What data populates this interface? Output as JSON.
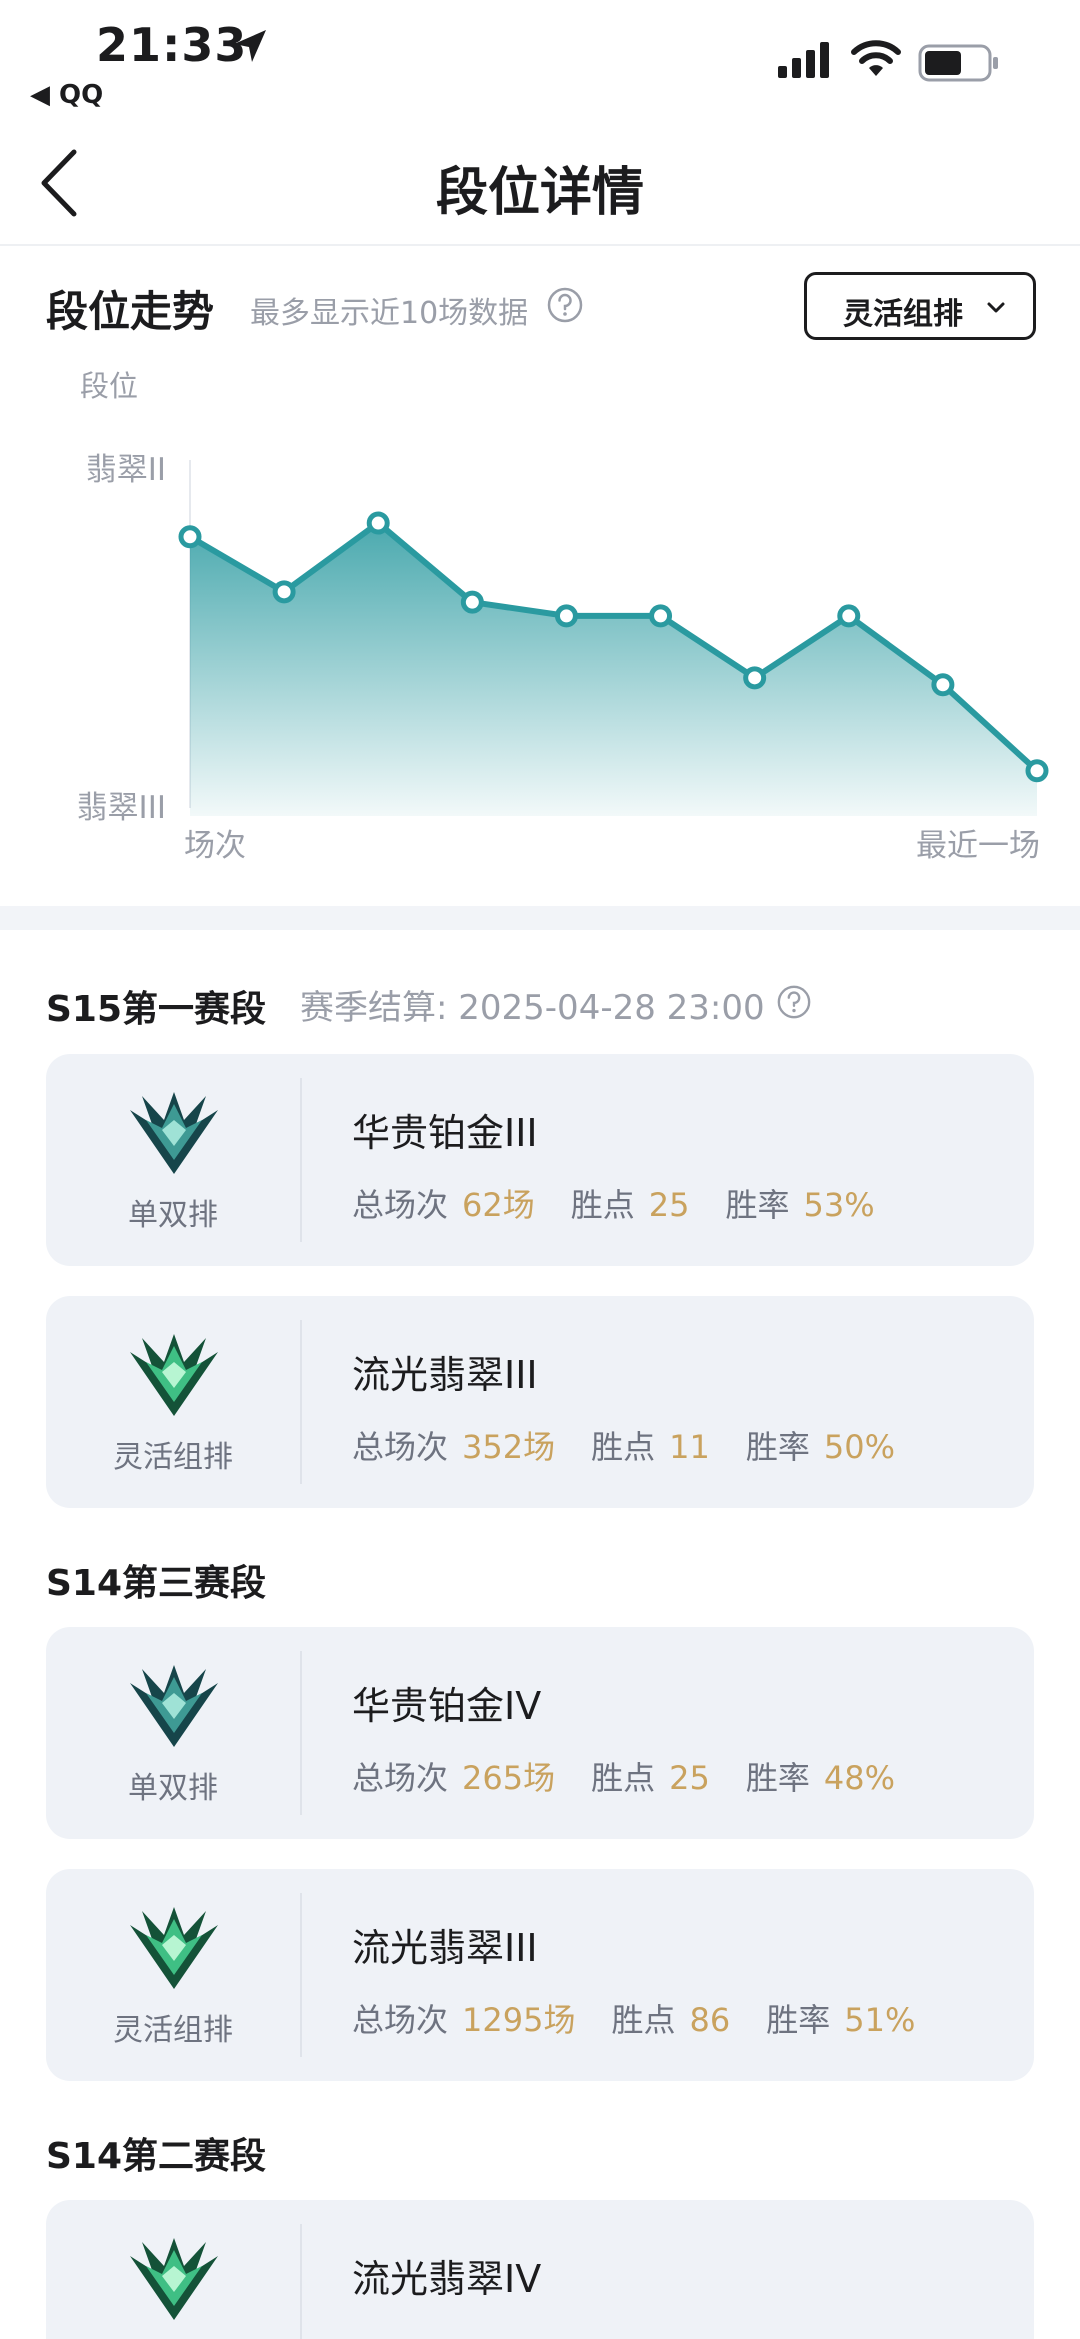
{
  "status_bar": {
    "time": "21:33",
    "back_app": "◀ QQ"
  },
  "nav": {
    "title": "段位详情"
  },
  "trend": {
    "title": "段位走势",
    "subtitle": "最多显示近10场数据",
    "mode_select": "灵活组排"
  },
  "chart_data": {
    "type": "area",
    "ylabel": "段位",
    "y_ticks": [
      "翡翠II",
      "翡翠III"
    ],
    "x_tick_labels": [
      "场次",
      "最近一场"
    ],
    "x": [
      1,
      2,
      3,
      4,
      5,
      6,
      7,
      8,
      9,
      10
    ],
    "values": [
      0.8,
      0.64,
      0.84,
      0.61,
      0.57,
      0.57,
      0.39,
      0.57,
      0.37,
      0.12
    ],
    "ylim": [
      0,
      1
    ],
    "grid": false,
    "color": "#2a9aa0"
  },
  "seasons": [
    {
      "title": "S15第一赛段",
      "settlement": "赛季结算: 2025-04-28 23:00",
      "cards": [
        {
          "queue": "单双排",
          "rank": "华贵铂金III",
          "k_games": "总场次",
          "games": "62场",
          "k_points": "胜点",
          "points": "25",
          "k_rate": "胜率",
          "rate": "53%"
        },
        {
          "queue": "灵活组排",
          "rank": "流光翡翠III",
          "k_games": "总场次",
          "games": "352场",
          "k_points": "胜点",
          "points": "11",
          "k_rate": "胜率",
          "rate": "50%"
        }
      ]
    },
    {
      "title": "S14第三赛段",
      "cards": [
        {
          "queue": "单双排",
          "rank": "华贵铂金IV",
          "k_games": "总场次",
          "games": "265场",
          "k_points": "胜点",
          "points": "25",
          "k_rate": "胜率",
          "rate": "48%"
        },
        {
          "queue": "灵活组排",
          "rank": "流光翡翠III",
          "k_games": "总场次",
          "games": "1295场",
          "k_points": "胜点",
          "points": "86",
          "k_rate": "胜率",
          "rate": "51%"
        }
      ]
    },
    {
      "title": "S14第二赛段",
      "cards": [
        {
          "rank": "流光翡翠IV"
        }
      ]
    }
  ],
  "colors": {
    "accent": "#2a9aa0",
    "gold": "#c9a25e",
    "card_bg": "#eff2f7",
    "emerald": "#3fbf84",
    "platinum": "#3e9a94"
  }
}
